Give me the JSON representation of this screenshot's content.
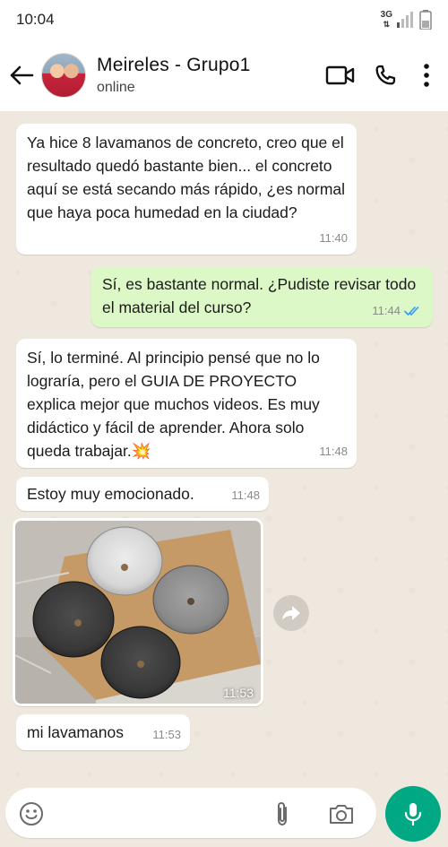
{
  "status_bar": {
    "time": "10:04",
    "network": "3G"
  },
  "header": {
    "contact_name": "Meireles - Grupo1",
    "contact_status": "online"
  },
  "messages": [
    {
      "direction": "in",
      "text": "Ya hice 8 lavamanos de concreto, creo que el resultado quedó bastante bien... el concreto aquí se está secando más rápido, ¿es normal que haya poca humedad en la ciudad?",
      "time": "11:40"
    },
    {
      "direction": "out",
      "text": "Sí, es bastante normal. ¿Pudiste revisar todo el material del curso?",
      "time": "11:44",
      "status": "read"
    },
    {
      "direction": "in",
      "text": "Sí, lo terminé. Al principio pensé que no lo lograría, pero el GUIA DE PROYECTO explica mejor que muchos videos. Es muy didáctico y fácil de aprender. Ahora solo queda trabajar.💥",
      "time": "11:48"
    },
    {
      "direction": "in",
      "text": "Estoy muy emocionado.",
      "time": "11:48"
    },
    {
      "direction": "in",
      "type": "image",
      "time": "11:53"
    },
    {
      "direction": "in",
      "text": "mi lavamanos",
      "time": "11:53"
    }
  ],
  "colors": {
    "chat_background": "#efe8df",
    "incoming_bubble": "#ffffff",
    "outgoing_bubble": "#dcf8c6",
    "read_ticks": "#3497f9",
    "mic_button": "#00a884"
  },
  "icons": {
    "back": "arrow-left-icon",
    "video_call": "video-camera-icon",
    "voice_call": "phone-icon",
    "menu": "more-vertical-icon",
    "emoji": "emoji-icon",
    "attach": "paperclip-icon",
    "camera": "camera-icon",
    "mic": "microphone-icon",
    "forward": "forward-icon"
  }
}
